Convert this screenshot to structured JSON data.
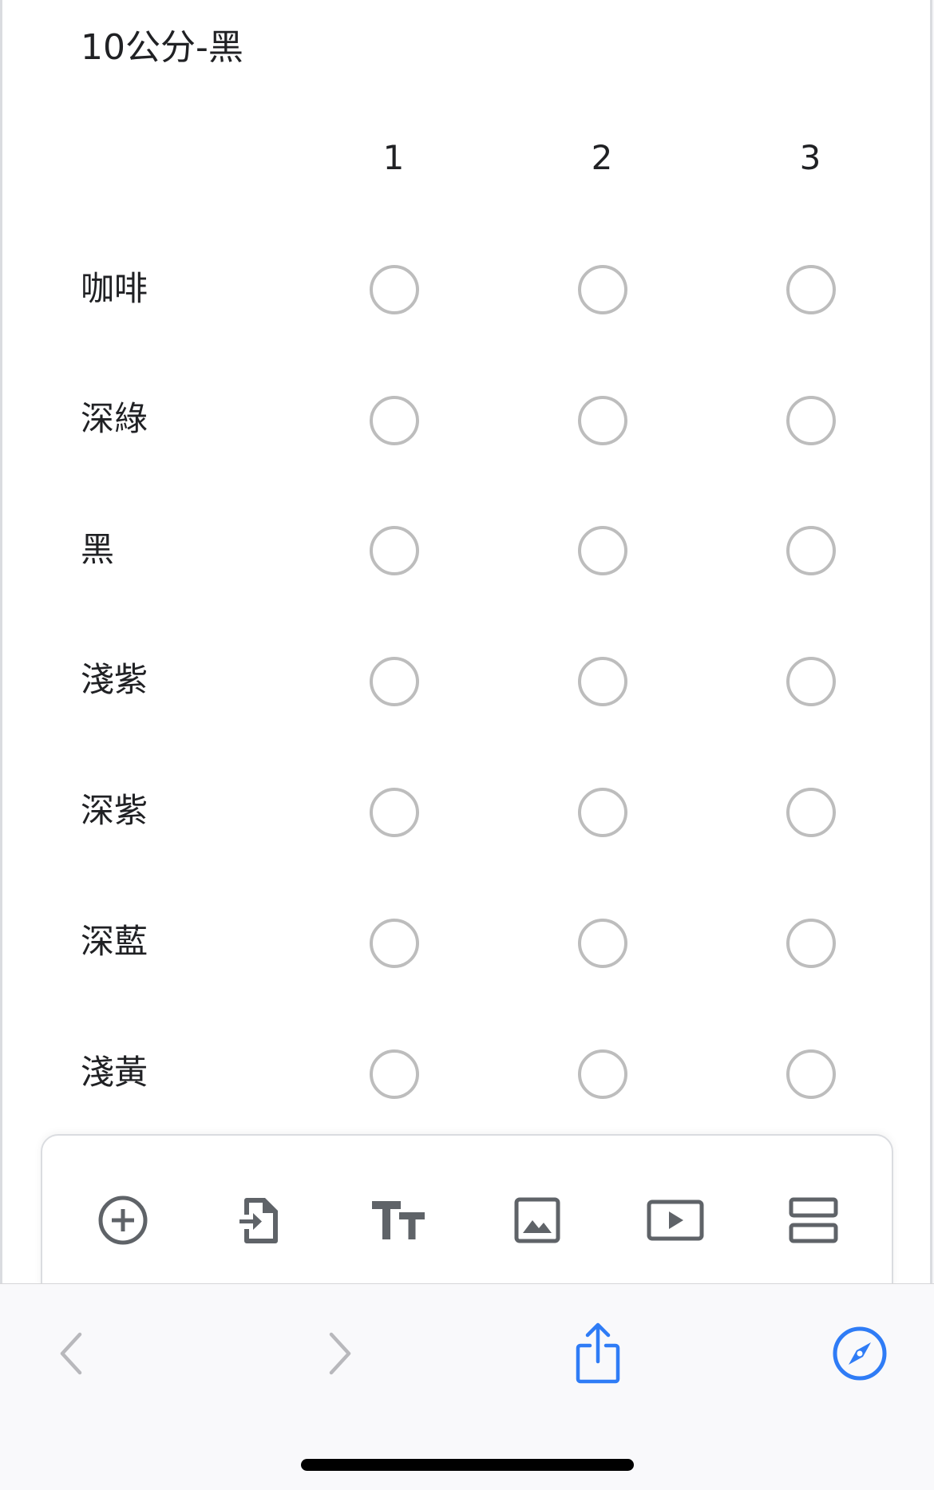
{
  "question": {
    "title": "10公分-黑"
  },
  "grid": {
    "columns": [
      "1",
      "2",
      "3"
    ],
    "rows": [
      "咖啡",
      "深綠",
      "黑",
      "淺紫",
      "深紫",
      "深藍",
      "淺黃"
    ]
  },
  "toolbar": {
    "icons": [
      "add-question-icon",
      "import-questions-icon",
      "add-title-icon",
      "add-image-icon",
      "add-video-icon",
      "add-section-icon"
    ],
    "icon_color": "#5f6368"
  },
  "browser": {
    "icons": [
      "back-chevron-icon",
      "forward-chevron-icon",
      "share-icon",
      "compass-icon"
    ],
    "accent_color": "#2f7cf6",
    "disabled_color": "#b8b8bc"
  },
  "colors": {
    "radio_border": "#bdbdbd",
    "text": "#202124"
  }
}
